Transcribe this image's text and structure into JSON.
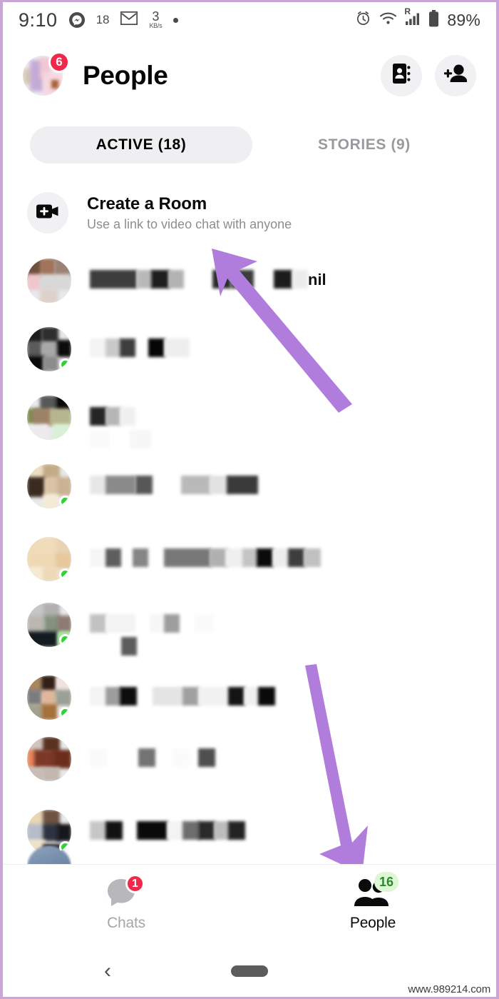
{
  "status_bar": {
    "time": "9:10",
    "messenger_icon": "messenger-icon",
    "messenger_count": "18",
    "gmail_icon": "gmail-icon",
    "network_speed_value": "3",
    "network_speed_unit": "KB/s",
    "extra_dot": "dot-indicator",
    "alarm_icon": "alarm-clock-icon",
    "wifi_icon": "wifi-icon",
    "signal_icon": "cellular-signal-icon",
    "roaming_label": "R",
    "battery_icon": "battery-icon",
    "battery_percent": "89%"
  },
  "header": {
    "profile_avatar": "profile-avatar",
    "profile_badge_count": "6",
    "title": "People",
    "contacts_icon": "contacts-book-icon",
    "add_person_icon": "add-person-icon"
  },
  "tabs": [
    {
      "label": "ACTIVE (18)",
      "active": true
    },
    {
      "label": "STORIES (9)",
      "active": false
    }
  ],
  "create_room": {
    "icon": "video-room-icon",
    "title": "Create a Room",
    "subtitle": "Use a link to video chat with anyone"
  },
  "people_list": {
    "rows": [
      {
        "name": "",
        "redacted": true,
        "online": false,
        "leftover_text": "nil"
      },
      {
        "name": "",
        "redacted": true,
        "online": true,
        "leftover_text": ""
      },
      {
        "name": "",
        "redacted": true,
        "online": false,
        "leftover_text": ""
      },
      {
        "name": "",
        "redacted": true,
        "online": true,
        "leftover_text": ""
      },
      {
        "name": "",
        "redacted": true,
        "online": true,
        "leftover_text": ""
      },
      {
        "name": "",
        "redacted": true,
        "online": true,
        "leftover_text": ""
      },
      {
        "name": "",
        "redacted": true,
        "online": true,
        "leftover_text": ""
      },
      {
        "name": "",
        "redacted": true,
        "online": false,
        "leftover_text": ""
      },
      {
        "name": "",
        "redacted": true,
        "online": true,
        "leftover_text": ""
      }
    ]
  },
  "annotations": {
    "arrow_color": "#b07ddc",
    "arrow_1_target": "create-room-row",
    "arrow_2_target": "people-nav-tab"
  },
  "bottom_nav": [
    {
      "label": "Chats",
      "icon": "chat-bubble-icon",
      "badge": "1",
      "badge_kind": "red",
      "active": false
    },
    {
      "label": "People",
      "icon": "people-icon",
      "badge": "16",
      "badge_kind": "green",
      "active": true
    }
  ],
  "system_nav": {
    "back_icon": "back-chevron-icon",
    "home_icon": "home-pill-icon"
  },
  "watermark": "www.989214.com",
  "colors": {
    "accent_purple": "#b07ddc",
    "badge_red": "#f02849",
    "badge_green_bg": "#ddf6d4",
    "badge_green_text": "#2c8a2c",
    "online_green": "#31d237",
    "frame_border": "#c9a6d6"
  }
}
